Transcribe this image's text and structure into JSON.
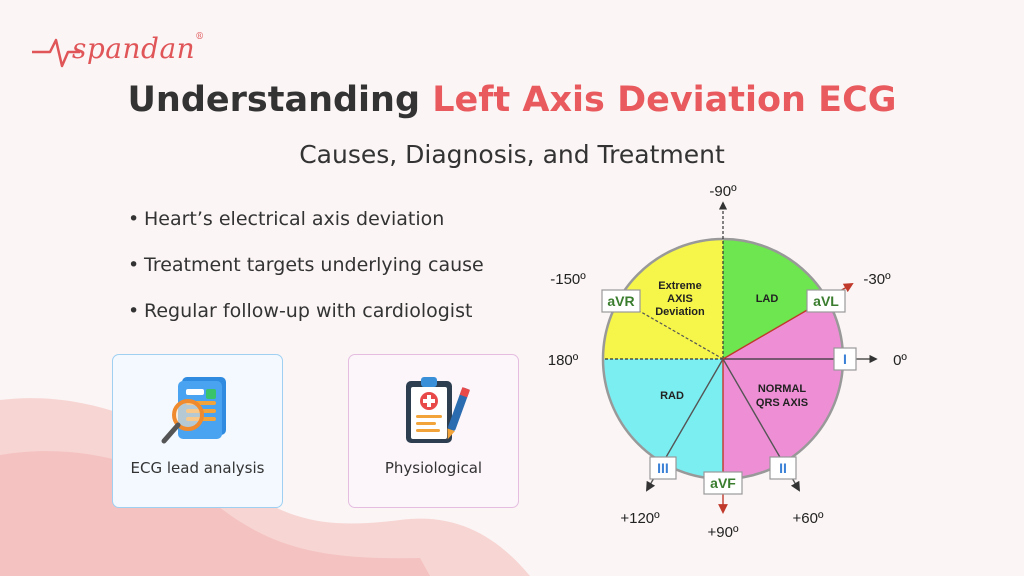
{
  "brand": {
    "name": "spandan",
    "reg": "®",
    "color": "#e05558"
  },
  "title": {
    "prefix": "Understanding",
    "highlight": "Left Axis Deviation ECG",
    "accent_color": "#e85a5d"
  },
  "subtitle": "Causes, Diagnosis, and Treatment",
  "bullets": [
    "Heart’s electrical axis deviation",
    "Treatment targets underlying cause",
    "Regular follow-up with cardiologist"
  ],
  "cards": [
    {
      "label": "ECG lead analysis",
      "icon": "document-magnifier-icon"
    },
    {
      "label": "Physiological",
      "icon": "clipboard-medical-icon"
    }
  ],
  "axis_diagram": {
    "angles": {
      "top": "-90º",
      "upper_left": "-150º",
      "upper_right": "-30º",
      "left": "180º",
      "right": "0º",
      "lower_left": "+120º",
      "bottom": "+90º",
      "lower_right": "+60º"
    },
    "leads": {
      "avr": "aVR",
      "avl": "aVL",
      "i": "I",
      "iii": "III",
      "avf": "aVF",
      "ii": "II"
    },
    "regions": {
      "extreme": [
        "Extreme",
        "AXIS",
        "Deviation"
      ],
      "lad": "LAD",
      "normal": [
        "NORMAL",
        "QRS AXIS"
      ],
      "rad": "RAD"
    },
    "colors": {
      "extreme": "#f5f54a",
      "lad": "#6de64f",
      "normal": "#ee8fd6",
      "rad": "#7beef2"
    }
  }
}
